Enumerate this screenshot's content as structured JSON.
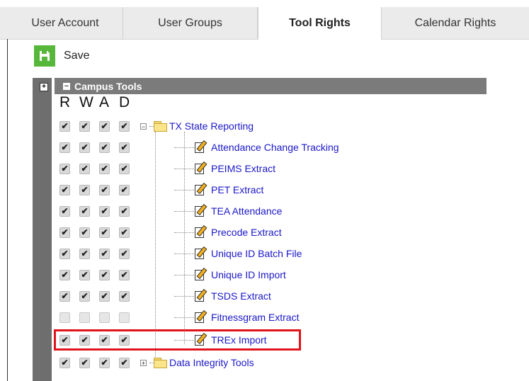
{
  "tabs": [
    {
      "label": "User Account",
      "active": false
    },
    {
      "label": "User Groups",
      "active": false
    },
    {
      "label": "Tool Rights",
      "active": true
    },
    {
      "label": "Calendar Rights",
      "active": false
    }
  ],
  "toolbar": {
    "save_label": "Save"
  },
  "tree": {
    "header": "Campus Tools",
    "columns": {
      "r": "R",
      "w": "W",
      "a": "A",
      "d": "D"
    },
    "folders": {
      "tx": "TX State Reporting",
      "data_integrity": "Data Integrity Tools"
    },
    "items": [
      {
        "label": "Attendance Change Tracking",
        "checked": true
      },
      {
        "label": "PEIMS Extract",
        "checked": true
      },
      {
        "label": "PET Extract",
        "checked": true
      },
      {
        "label": "TEA Attendance",
        "checked": true
      },
      {
        "label": "Precode Extract",
        "checked": true
      },
      {
        "label": "Unique ID Batch File",
        "checked": true
      },
      {
        "label": "Unique ID Import",
        "checked": true
      },
      {
        "label": "TSDS Extract",
        "checked": true
      },
      {
        "label": "Fitnessgram Extract",
        "checked": false
      },
      {
        "label": "TREx Import",
        "checked": true
      }
    ]
  },
  "colors": {
    "accent_save": "#57b73a",
    "highlight": "#e0141a",
    "link": "#1a17c9"
  }
}
